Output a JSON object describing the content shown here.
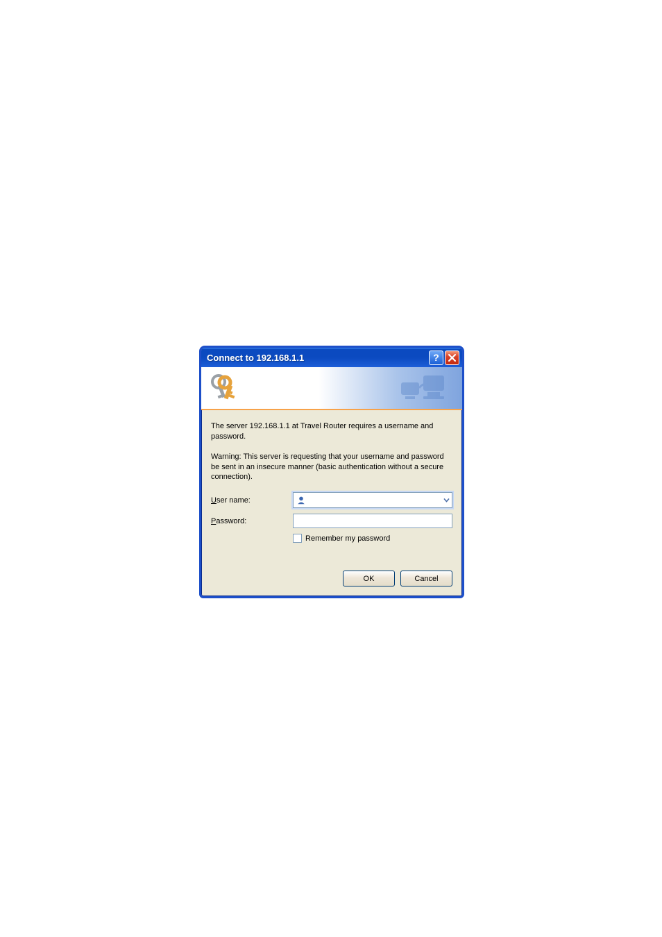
{
  "dialog": {
    "title": "Connect to 192.168.1.1",
    "message1": "The server 192.168.1.1 at Travel Router requires a username and password.",
    "message2": "Warning: This server is requesting that your username and password be sent in an insecure manner (basic authentication without a secure connection).",
    "username_label_pre": "U",
    "username_label_rest": "ser name:",
    "password_label_pre": "P",
    "password_label_rest": "assword:",
    "username_value": "",
    "password_value": "",
    "remember_pre": "R",
    "remember_rest": "emember my password",
    "remember_checked": false,
    "ok_label": "OK",
    "cancel_label": "Cancel"
  }
}
